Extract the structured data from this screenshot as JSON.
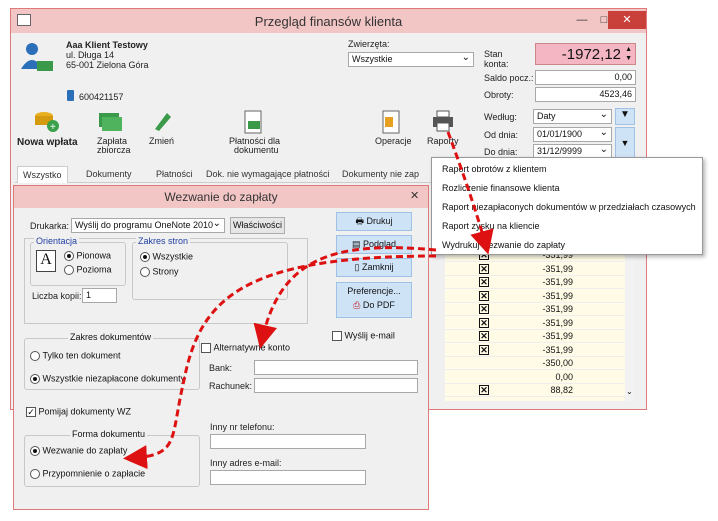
{
  "main": {
    "title": "Przegląd finansów klienta",
    "client": {
      "name": "Aaa Klient Testowy",
      "street": "ul. Długa 14",
      "city": "65-001 Zielona Góra",
      "phone": "600421157"
    },
    "animals": {
      "label": "Zwierzęta:",
      "value": "Wszystkie"
    },
    "balance": {
      "label1": "Stan",
      "label2": "konta:",
      "value": "-1972,12",
      "color": "#f4b6c2"
    },
    "saldo": {
      "label": "Saldo pocz.:",
      "value": "0,00"
    },
    "obroty": {
      "label": "Obroty:",
      "value": "4523,46"
    },
    "wedlug": {
      "label": "Według:",
      "value": "Daty"
    },
    "od": {
      "label": "Od dnia:",
      "value": "01/01/1900"
    },
    "do": {
      "label": "Do dnia:",
      "value": "31/12/9999"
    },
    "toolbar": {
      "nowa": "Nowa wpłata",
      "zaplata1": "Zapłata",
      "zaplata2": "zbiorcza",
      "zmien": "Zmień",
      "platnosci1": "Płatności dla",
      "platnosci2": "dokumentu",
      "operacje": "Operacje",
      "raporty": "Raporty"
    },
    "tabs": [
      "Wszystko",
      "Dokumenty",
      "Płatności",
      "Dok. nie wymagające płatności",
      "Dokumenty nie zap"
    ],
    "amounts": [
      "-351,99",
      "-351,99",
      "-351,99",
      "-351,99",
      "-351,99",
      "-351,99",
      "-351,99",
      "-351,99",
      "-350,00",
      "0,00",
      "88,82"
    ],
    "checked": [
      true,
      true,
      true,
      true,
      true,
      true,
      true,
      true,
      false,
      false,
      true
    ]
  },
  "menu": {
    "items": [
      "Raport obrotów z klientem",
      "Rozliczenie finansowe klienta",
      "Raport niezapłaconych dokumentów w przedziałach czasowych",
      "Raport zysku na kliencie",
      "Wydrukuj wezwanie do zapłaty"
    ]
  },
  "dialog": {
    "title": "Wezwanie do zapłaty",
    "printer_label": "Drukarka:",
    "printer_value": "Wyślij do programu OneNote 2010",
    "properties": "Właściwości",
    "orient": {
      "title": "Orientacja",
      "portrait": "Pionowa",
      "landscape": "Pozioma"
    },
    "pages": {
      "title": "Zakres stron",
      "all": "Wszystkie",
      "some": "Strony"
    },
    "copies": {
      "label": "Liczba kopii:",
      "value": "1"
    },
    "buttons": {
      "print": "Drukuj",
      "preview": "Podgląd",
      "close": "Zamknij",
      "prefs": "Preferencje...",
      "pdf": "Do PDF"
    },
    "email_chk": "Wyślij e-mail",
    "docrange": {
      "title": "Zakres dokumentów",
      "only": "Tylko ten dokument",
      "all": "Wszystkie niezapłacone dokumenty"
    },
    "alt_account": "Alternatywne konto",
    "bank": "Bank:",
    "account": "Rachunek:",
    "skip_wz": "Pomijaj dokumenty WZ",
    "form": {
      "title": "Forma dokumentu",
      "payment": "Wezwanie do zapłaty",
      "reminder": "Przypomnienie o zapłacie"
    },
    "phone_label": "Inny nr telefonu:",
    "email_label": "Inny adres e-mail:"
  }
}
